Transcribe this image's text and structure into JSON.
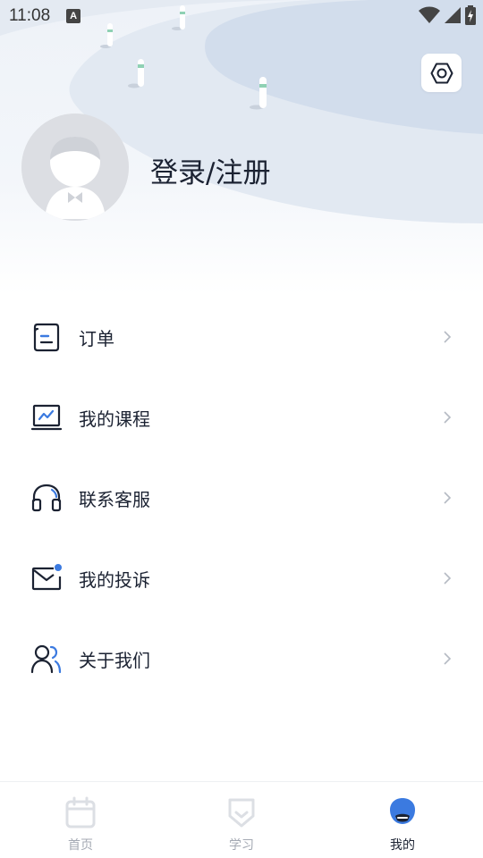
{
  "status_bar": {
    "time": "11:08",
    "app_icon_letter": "A"
  },
  "profile": {
    "login_label": "登录/注册"
  },
  "menu": {
    "items": [
      {
        "label": "订单",
        "icon": "order-document-icon"
      },
      {
        "label": "我的课程",
        "icon": "course-chart-icon"
      },
      {
        "label": "联系客服",
        "icon": "headset-icon"
      },
      {
        "label": "我的投诉",
        "icon": "mail-icon"
      },
      {
        "label": "关于我们",
        "icon": "people-icon"
      }
    ]
  },
  "tabbar": {
    "tabs": [
      {
        "label": "首页",
        "icon": "calendar-icon",
        "active": false
      },
      {
        "label": "学习",
        "icon": "shield-icon",
        "active": false
      },
      {
        "label": "我的",
        "icon": "profile-icon",
        "active": true
      }
    ]
  },
  "colors": {
    "accent": "#3b7ae0",
    "text": "#1b2232",
    "inactive": "#a4a9b3",
    "inactive_icon": "#dcdfe4"
  }
}
